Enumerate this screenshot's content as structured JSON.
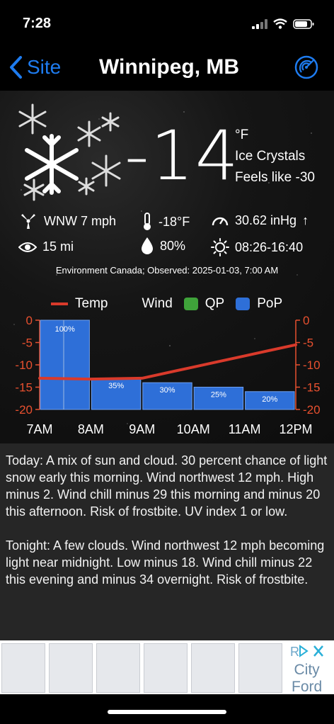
{
  "status": {
    "time": "7:28"
  },
  "nav": {
    "back_label": "Site",
    "title": "Winnipeg, MB"
  },
  "current": {
    "temperature": "-14",
    "unit": "°F",
    "condition": "Ice Crystals",
    "feels_like": "Feels like -30",
    "wind": "WNW 7 mph",
    "dewpoint": "-18°F",
    "pressure": "30.62 inHg",
    "pressure_trend": "↑",
    "visibility": "15 mi",
    "humidity": "80%",
    "sun": "08:26-16:40",
    "observed": "Environment Canada; Observed: 2025-01-03, 7:00 AM"
  },
  "legend": {
    "temp": "Temp",
    "wind": "Wind",
    "qp": "QP",
    "pop": "PoP"
  },
  "colors": {
    "accent": "#1e7cf0",
    "temp_line": "#d93a2b",
    "pop_bar": "#2e6fd8",
    "qp": "#3fa33a",
    "axis": "#e8502f"
  },
  "chart_data": {
    "type": "bar",
    "categories": [
      "7AM",
      "8AM",
      "9AM",
      "10AM",
      "11AM",
      "12PM"
    ],
    "pop_values": [
      100,
      35,
      30,
      25,
      20
    ],
    "pop_labels": [
      "100%",
      "35%",
      "30%",
      "25%",
      "20%"
    ],
    "temp_series": {
      "name": "Temp",
      "x": [
        0,
        1,
        2,
        3,
        4,
        5
      ],
      "values": [
        -13,
        -13.2,
        -13,
        -10.5,
        -8,
        -5.5
      ]
    },
    "y_ticks": [
      "0",
      "-5",
      "-10",
      "-15",
      "-20"
    ],
    "ylim": [
      -20,
      0
    ],
    "grid": false
  },
  "forecast": {
    "today": "Today:  A mix of sun and cloud. 30 percent chance of light snow early this morning. Wind northwest 12 mph. High minus 2. Wind chill minus 29 this morning and minus 20 this afternoon. Risk of frostbite. UV index 1 or low.",
    "tonight": "Tonight:  A few clouds. Wind northwest 12 mph becoming light near midnight. Low minus 18. Wind chill minus 22 this evening and minus 34 overnight. Risk of frostbite."
  },
  "ad": {
    "brand": "City\nFord",
    "brand_line1": "City",
    "brand_line2": "Ford"
  }
}
